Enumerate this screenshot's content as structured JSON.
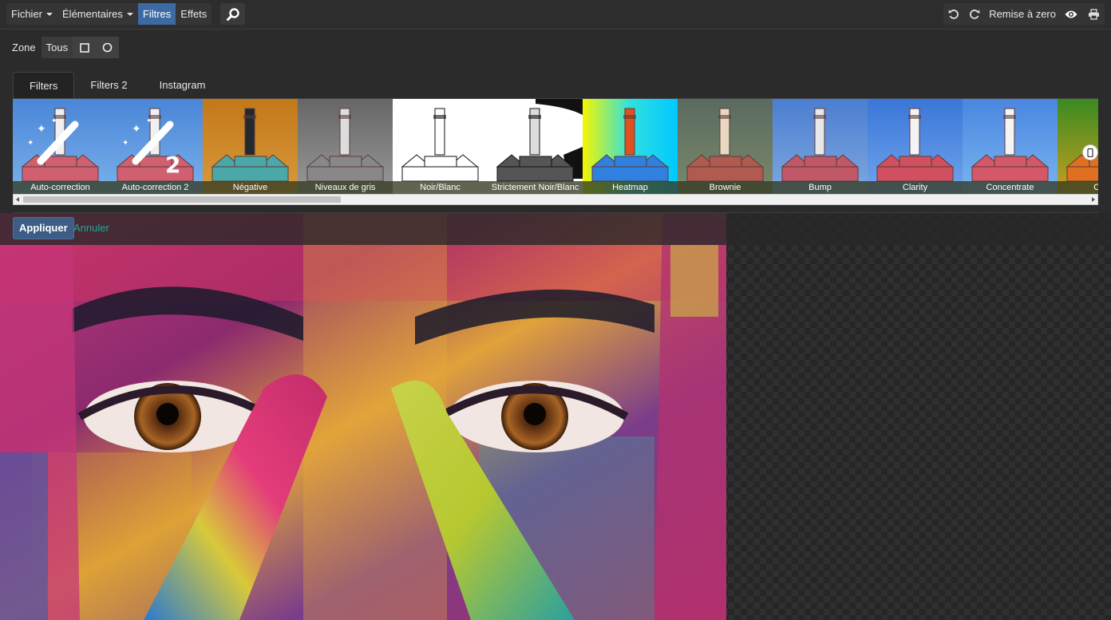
{
  "menubar": {
    "items": [
      {
        "label": "Fichier",
        "dropdown": true,
        "active": false
      },
      {
        "label": "Élémentaires",
        "dropdown": true,
        "active": false
      },
      {
        "label": "Filtres",
        "dropdown": false,
        "active": true
      },
      {
        "label": "Effets",
        "dropdown": false,
        "active": false
      }
    ],
    "search_icon": "search-icon"
  },
  "toolbar_right": {
    "undo_icon": "undo-icon",
    "redo_icon": "redo-icon",
    "reset_label": "Remise à zero",
    "preview_icon": "eye-icon",
    "print_icon": "printer-icon"
  },
  "zone": {
    "label": "Zone",
    "all_label": "Tous",
    "rect_icon": "square-icon",
    "ellipse_icon": "circle-icon"
  },
  "tabs": [
    {
      "label": "Filters",
      "active": true
    },
    {
      "label": "Filters 2",
      "active": false
    },
    {
      "label": "Instagram",
      "active": false
    }
  ],
  "filters": [
    {
      "label": "Auto-correction"
    },
    {
      "label": "Auto-correction 2"
    },
    {
      "label": "Négative"
    },
    {
      "label": "Niveaux de gris"
    },
    {
      "label": "Noir/Blanc"
    },
    {
      "label": "Strictement Noir/Blanc"
    },
    {
      "label": "Heatmap"
    },
    {
      "label": "Brownie"
    },
    {
      "label": "Bump"
    },
    {
      "label": "Clarity"
    },
    {
      "label": "Concentrate"
    },
    {
      "label": "Cross"
    }
  ],
  "actions": {
    "apply_label": "Appliquer",
    "cancel_label": "Annuler"
  },
  "colors": {
    "accent": "#3c6aa3",
    "cancel_link": "#26a69a"
  }
}
